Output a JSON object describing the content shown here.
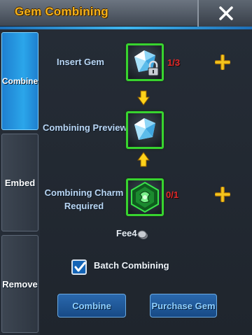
{
  "window": {
    "title": "Gem Combining"
  },
  "tabs": [
    {
      "label": "Combine",
      "active": true
    },
    {
      "label": "Embed",
      "active": false
    },
    {
      "label": "Remove",
      "active": false
    }
  ],
  "insert_gem": {
    "label": "Insert Gem",
    "count": "1/3"
  },
  "preview": {
    "label": "Combining Preview"
  },
  "charm": {
    "label_line1": "Combining Charm",
    "label_line2": "Required",
    "count": "0/1"
  },
  "fee": {
    "label": "Fee",
    "amount": "4"
  },
  "batch": {
    "label": "Batch Combining",
    "checked": true
  },
  "buttons": {
    "combine": "Combine",
    "purchase": "Purchase Gem"
  },
  "icons": {
    "close": "close-icon",
    "gem": "gem-icon",
    "lock": "lock-icon",
    "charm": "charm-icon",
    "plus": "plus-icon",
    "arrow": "arrow-down-icon",
    "coin": "coin-icon",
    "check": "checkmark-icon"
  },
  "colors": {
    "title": "#f6b21c",
    "active_tab": "#2ba6ea",
    "slot_border": "#38d42f",
    "count_red": "#e02a2a",
    "plus_gold": "#f5c51c",
    "label_blue": "#b9d6f4"
  }
}
